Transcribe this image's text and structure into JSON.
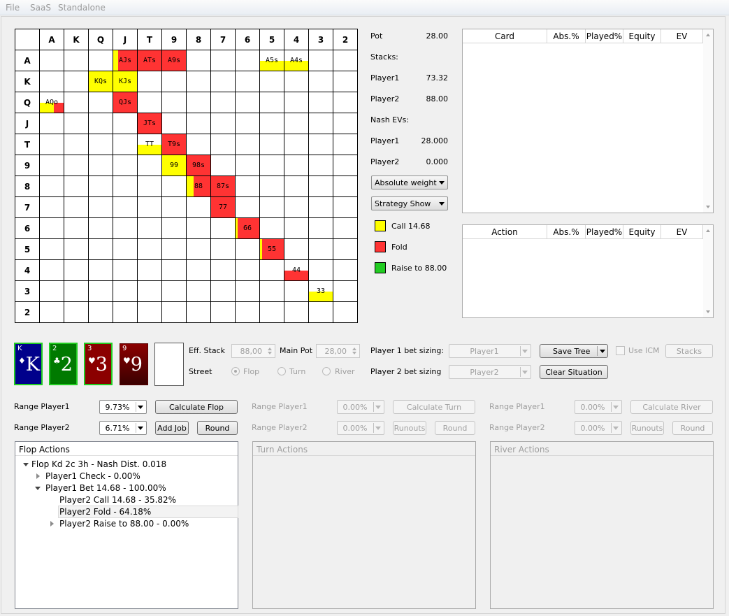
{
  "menu": [
    "File",
    "SaaS",
    "Standalone"
  ],
  "grid": {
    "ranks": [
      "A",
      "K",
      "Q",
      "J",
      "T",
      "9",
      "8",
      "7",
      "6",
      "5",
      "4",
      "3",
      "2"
    ],
    "cells": [
      {
        "r": 0,
        "c": 3,
        "label": "AJs",
        "segments": [
          [
            "#ffff00",
            0.2
          ],
          [
            "#ff3333",
            0.8
          ]
        ],
        "full": true
      },
      {
        "r": 0,
        "c": 4,
        "label": "ATs",
        "segments": [
          [
            "#ff3333",
            1
          ]
        ],
        "full": true
      },
      {
        "r": 0,
        "c": 5,
        "label": "A9s",
        "segments": [
          [
            "#ff3333",
            1
          ]
        ],
        "full": true
      },
      {
        "r": 0,
        "c": 9,
        "label": "A5s",
        "segments": [
          [
            "#ffff00",
            1
          ]
        ],
        "full": false
      },
      {
        "r": 0,
        "c": 10,
        "label": "A4s",
        "segments": [
          [
            "#ffff00",
            1
          ]
        ],
        "full": false
      },
      {
        "r": 1,
        "c": 2,
        "label": "KQs",
        "segments": [
          [
            "#ffff00",
            1
          ]
        ],
        "full": true
      },
      {
        "r": 1,
        "c": 3,
        "label": "KJs",
        "segments": [
          [
            "#ffff00",
            1
          ]
        ],
        "full": true
      },
      {
        "r": 2,
        "c": 0,
        "label": "AQo",
        "segments": [
          [
            "#ffff00",
            0.6
          ],
          [
            "#ff3333",
            0.4
          ]
        ],
        "full": false
      },
      {
        "r": 2,
        "c": 3,
        "label": "QJs",
        "segments": [
          [
            "#ff3333",
            1
          ]
        ],
        "full": true
      },
      {
        "r": 3,
        "c": 4,
        "label": "JTs",
        "segments": [
          [
            "#ff3333",
            1
          ]
        ],
        "full": true
      },
      {
        "r": 4,
        "c": 4,
        "label": "TT",
        "segments": [
          [
            "#ffff00",
            1
          ]
        ],
        "full": false
      },
      {
        "r": 4,
        "c": 5,
        "label": "T9s",
        "segments": [
          [
            "#ff3333",
            1
          ]
        ],
        "full": true
      },
      {
        "r": 5,
        "c": 5,
        "label": "99",
        "segments": [
          [
            "#ffff00",
            1
          ]
        ],
        "full": true
      },
      {
        "r": 5,
        "c": 6,
        "label": "98s",
        "segments": [
          [
            "#ff3333",
            1
          ]
        ],
        "full": true
      },
      {
        "r": 6,
        "c": 6,
        "label": "88",
        "segments": [
          [
            "#ffff00",
            0.3
          ],
          [
            "#ff3333",
            0.7
          ]
        ],
        "full": true
      },
      {
        "r": 6,
        "c": 7,
        "label": "87s",
        "segments": [
          [
            "#ff3333",
            1
          ]
        ],
        "full": true
      },
      {
        "r": 7,
        "c": 7,
        "label": "77",
        "segments": [
          [
            "#ff3333",
            1
          ]
        ],
        "full": true
      },
      {
        "r": 8,
        "c": 8,
        "label": "66",
        "segments": [
          [
            "#ffff00",
            0.1
          ],
          [
            "#ff3333",
            0.9
          ]
        ],
        "full": true
      },
      {
        "r": 9,
        "c": 9,
        "label": "55",
        "segments": [
          [
            "#ffff00",
            0.1
          ],
          [
            "#ff3333",
            0.9
          ]
        ],
        "full": true
      },
      {
        "r": 10,
        "c": 10,
        "label": "44",
        "segments": [
          [
            "#ff3333",
            1
          ]
        ],
        "full": false
      },
      {
        "r": 11,
        "c": 11,
        "label": "33",
        "segments": [
          [
            "#ffff00",
            1
          ]
        ],
        "full": false
      }
    ]
  },
  "info": {
    "pot_label": "Pot",
    "pot": "28.00",
    "stacks_label": "Stacks:",
    "p1_label": "Player1",
    "p1_stack": "73.32",
    "p2_label": "Player2",
    "p2_stack": "88.00",
    "nash_label": "Nash EVs:",
    "p1_ev": "28.000",
    "p2_ev": "0.000",
    "weight_select": "Absolute weight",
    "strategy_select": "Strategy Show"
  },
  "legend": [
    {
      "label": "Call 14.68",
      "color": "#ffff00"
    },
    {
      "label": "Fold",
      "color": "#ff3333"
    },
    {
      "label": "Raise to 88.00",
      "color": "#22cc22"
    }
  ],
  "card_table": {
    "cols": [
      "Card",
      "Abs.%",
      "Played%",
      "Equity",
      "EV"
    ]
  },
  "action_table": {
    "cols": [
      "Action",
      "Abs.%",
      "Played%",
      "Equity",
      "EV"
    ]
  },
  "board": [
    {
      "rank": "K",
      "suit": "♦",
      "bg": "#00008b",
      "border": "#22cc22"
    },
    {
      "rank": "2",
      "suit": "♣",
      "bg": "#007a00",
      "border": "#22cc22"
    },
    {
      "rank": "3",
      "suit": "♥",
      "bg": "#8b0000",
      "border": "#22cc22"
    },
    {
      "rank": "9",
      "suit": "♥",
      "bg": "#8b0000",
      "border": "#5a0000"
    }
  ],
  "settings": {
    "eff_stack_label": "Eff. Stack",
    "eff_stack": "88,00",
    "main_pot_label": "Main Pot",
    "main_pot": "28,00",
    "street_label": "Street",
    "flop": "Flop",
    "turn": "Turn",
    "river": "River",
    "p1_bet_label": "Player 1 bet sizing:",
    "p1_bet": "Player1",
    "p2_bet_label": "Player 2 bet sizing",
    "p2_bet": "Player2",
    "save_tree": "Save Tree",
    "clear": "Clear Situation",
    "use_icm": "Use ICM",
    "stacks": "Stacks"
  },
  "flop_ctrl": {
    "range_p1_label": "Range Player1",
    "range_p1": "9.73%",
    "range_p2_label": "Range Player2",
    "range_p2": "6.71%",
    "calc": "Calculate Flop",
    "add_job": "Add Job",
    "round": "Round"
  },
  "turn_ctrl": {
    "range_p1_label": "Range Player1",
    "range_p1": "0.00%",
    "range_p2_label": "Range Player2",
    "range_p2": "0.00%",
    "calc": "Calculate Turn",
    "runouts": "Runouts",
    "round": "Round"
  },
  "river_ctrl": {
    "range_p1_label": "Range Player1",
    "range_p1": "0.00%",
    "range_p2_label": "Range Player2",
    "range_p2": "0.00%",
    "calc": "Calculate River",
    "runouts": "Runouts",
    "round": "Round"
  },
  "flop_actions": {
    "title": "Flop Actions",
    "root": "Flop Kd 2c 3h - Nash Dist. 0.018",
    "n1": "Player1 Check - 0.00%",
    "n2": "Player1 Bet 14.68 - 100.00%",
    "n3": "Player2 Call 14.68 - 35.82%",
    "n4": "Player2 Fold - 64.18%",
    "n5": "Player2 Raise to 88.00 - 0.00%"
  },
  "turn_actions": {
    "title": "Turn Actions"
  },
  "river_actions": {
    "title": "River Actions"
  }
}
